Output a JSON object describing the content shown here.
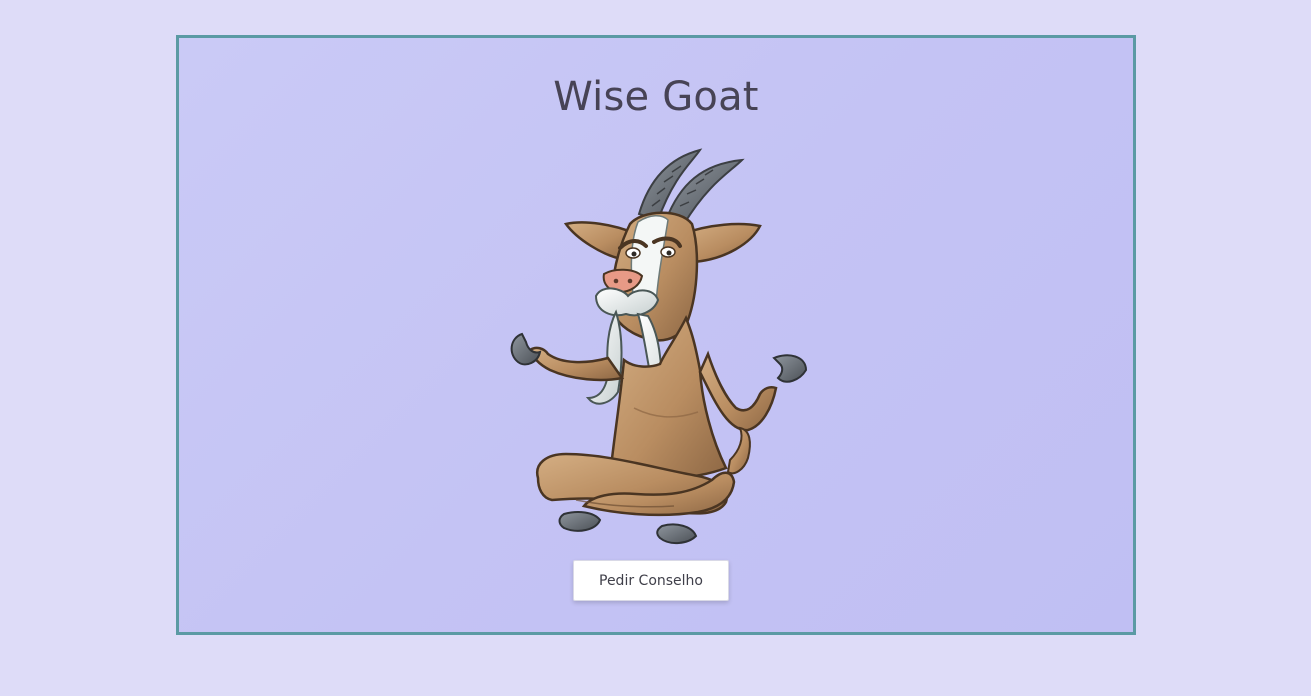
{
  "app": {
    "title": "Wise Goat"
  },
  "illustration": {
    "subject": "meditating goat",
    "icon": "goat-illustration"
  },
  "actions": {
    "ask_advice_label": "Pedir Conselho"
  },
  "colors": {
    "page_background": "#dedcf8",
    "card_background": "#c4c3f4",
    "card_border": "#5b9aa4",
    "title_text": "#474355",
    "button_background": "#ffffff"
  }
}
